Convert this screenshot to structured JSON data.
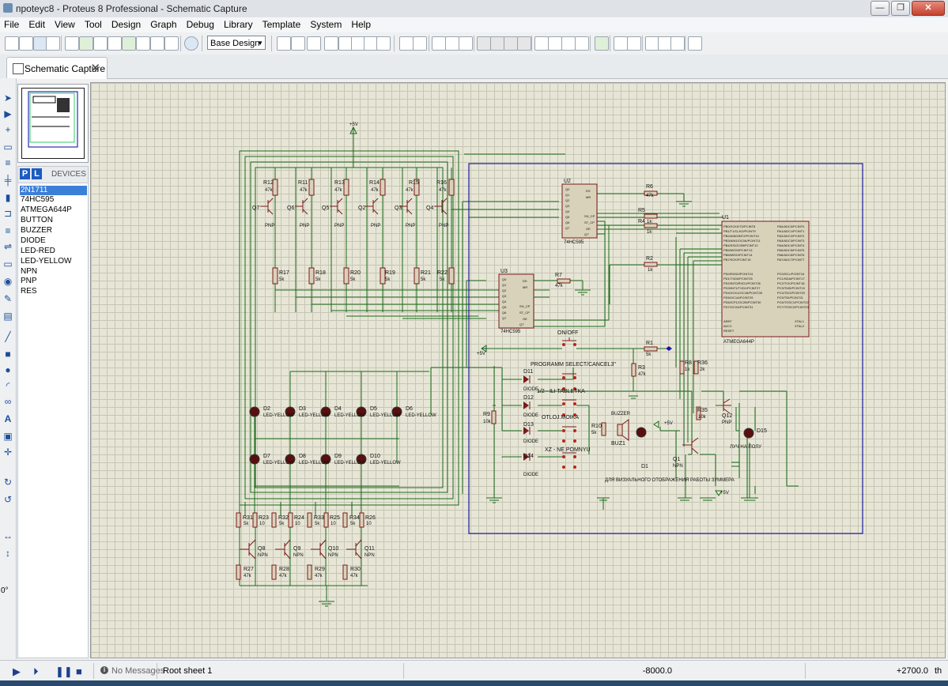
{
  "window": {
    "title": "проteус8 - Proteus 8 Professional - Schematic Capture",
    "min_label": "—",
    "max_label": "❐",
    "close_label": "✕"
  },
  "menu": [
    "File",
    "Edit",
    "View",
    "Tool",
    "Design",
    "Graph",
    "Debug",
    "Library",
    "Template",
    "System",
    "Help"
  ],
  "toolbar": {
    "design_select": "Base Design"
  },
  "tabs": [
    {
      "label": "Schematic Capture",
      "close": "✕"
    }
  ],
  "devices": {
    "p_label": "P",
    "l_label": "L",
    "title": "DEVICES",
    "items": [
      "2N1711",
      "74HC595",
      "ATMEGA644P",
      "BUTTON",
      "BUZZER",
      "DIODE",
      "LED-RED",
      "LED-YELLOW",
      "NPN",
      "PNP",
      "RES"
    ],
    "selected_index": 0
  },
  "left_tools": {
    "angle": "0°"
  },
  "schematic": {
    "power_top": "+5V",
    "u1": "U1",
    "u1_part": "ATMEGA644P",
    "u2": "U2",
    "u2_part": "74HC595",
    "u3": "U3",
    "u3_part": "74HC595",
    "pnp_upper": [
      {
        "r": "R12",
        "q": "Q7"
      },
      {
        "r": "R11",
        "q": "Q6"
      },
      {
        "r": "R13",
        "q": "Q5"
      },
      {
        "r": "R14",
        "q": "Q2"
      },
      {
        "r": "R15",
        "q": "Q3"
      },
      {
        "r": "R16",
        "q": "Q4"
      }
    ],
    "r_lower": [
      "R17",
      "R18",
      "R20",
      "R19",
      "R21",
      "R22"
    ],
    "pnp_label": "PNP",
    "npn_label": "NPN",
    "val_47k": "47k",
    "val_5k": "5k",
    "val_1k": "1k",
    "val_10k": "10k",
    "val_10": "10",
    "val_2k": "2k",
    "right_res": {
      "r6": "R6",
      "r5": "R5",
      "r4": "R4",
      "r2": "R2",
      "r7": "R7",
      "r1": "R1",
      "r3": "R3",
      "r8": "R8",
      "r36": "R36",
      "r35": "R35",
      "r9": "R9",
      "r10": "R10"
    },
    "led_row1": [
      {
        "d": "D2"
      },
      {
        "d": "D3"
      },
      {
        "d": "D4"
      },
      {
        "d": "D5"
      },
      {
        "d": "D6"
      }
    ],
    "led_row2": [
      {
        "d": "D7"
      },
      {
        "d": "D8"
      },
      {
        "d": "D9"
      },
      {
        "d": "D10"
      }
    ],
    "led_label": "LED-YELLOW",
    "npn_row": [
      {
        "q": "Q8",
        "ra": "R31",
        "rb": "R23",
        "rc": "R27"
      },
      {
        "q": "Q9",
        "ra": "R32",
        "rb": "R24",
        "rc": "R28"
      },
      {
        "q": "Q10",
        "ra": "R33",
        "rb": "R25",
        "rc": "R29"
      },
      {
        "q": "Q11",
        "ra": "R34",
        "rb": "R26",
        "rc": "R30"
      }
    ],
    "onoff": "ON/OFF",
    "prog_select": "PROGRAMM SELECT/CANCEL3\"",
    "btn2": "1/2 - ILI TABLETKA",
    "btn3": "OTLOJ.MOIKA",
    "btn4": "XZ - NE POMNYU",
    "diodes": [
      "D11",
      "D12",
      "D13",
      "D14"
    ],
    "diode_label": "DIODE",
    "buzzer": "BUZZER",
    "buz1": "BUZ1",
    "d1": "D1",
    "q1": "Q1",
    "q12": "Q12",
    "d15": "D15",
    "d15_note": "ЛУЧ НА ПОЛУ",
    "bottom_note": "ДЛЯ ВИЗУАЛЬНОГО ОТОБРАЖЕНИЯ РАБОТЫ ЗУММЕРА",
    "p5v": "+5V",
    "u1_pins_left": [
      "PB0/XCK0/T0/PCINT8",
      "PB1/T1/CLKO/PCINT9",
      "PB2/AIN0/INT2/PCINT10",
      "PB3/AIN1/OC0A/PCINT11",
      "PB4/SS/OC0B/PCINT12",
      "PB5/MOSI/PCINT13",
      "PB6/MISO/PCINT14",
      "PB7/SCK/PCINT15",
      "",
      "PD0/RXD0/PCINT24",
      "PD1/TXD0/PCINT25",
      "PD2/INT0/RXD1/PCINT26",
      "PD3/INT1/TXD1/PCINT27",
      "PD4/XCK1/OC1B/PCINT28",
      "PD5/OC1A/PCINT29",
      "PD6/ICP1/OC2B/PCINT30",
      "PD7/OC2A/PCINT31",
      "",
      "AREF",
      "AVCC",
      "RESET"
    ],
    "u1_pins_right": [
      "PA0/ADC0/PCINT0",
      "PA1/ADC1/PCINT1",
      "PA2/ADC2/PCINT2",
      "PA3/ADC3/PCINT3",
      "PA4/ADC4/PCINT4",
      "PA5/ADC5/PCINT5",
      "PA6/ADC6/PCINT6",
      "PA7/ADC7/PCINT7",
      "",
      "PC0/SCL/PCINT16",
      "PC1/SDA/PCINT17",
      "PC2/TCK/PCINT18",
      "PC3/TMS/PCINT19",
      "PC4/TDO/PCINT20",
      "PC5/TDI/PCINT21",
      "PC6/TOSC1/PCINT22",
      "PC7/TOSC2/PCINT23",
      "",
      "XTAL1",
      "XTAL2",
      ""
    ],
    "sr_pins_left": [
      "Q0",
      "Q1",
      "Q2",
      "Q3",
      "Q4",
      "Q5",
      "Q6",
      "Q7"
    ],
    "sr_pins_right": [
      "DS",
      "MR",
      "SH_CP",
      "ST_CP",
      "OE",
      "Q7'"
    ]
  },
  "status": {
    "messages": "No Messages",
    "sheet": "Root sheet 1",
    "x": "-8000.0",
    "y": "+2700.0",
    "unit": "th"
  },
  "colors": {
    "wire": "#1a6b1a",
    "component": "#7a1a1a",
    "box_blue": "#1a1a9c",
    "led_fill": "#5a0f0f",
    "grid_bg": "#e7e6d6"
  }
}
